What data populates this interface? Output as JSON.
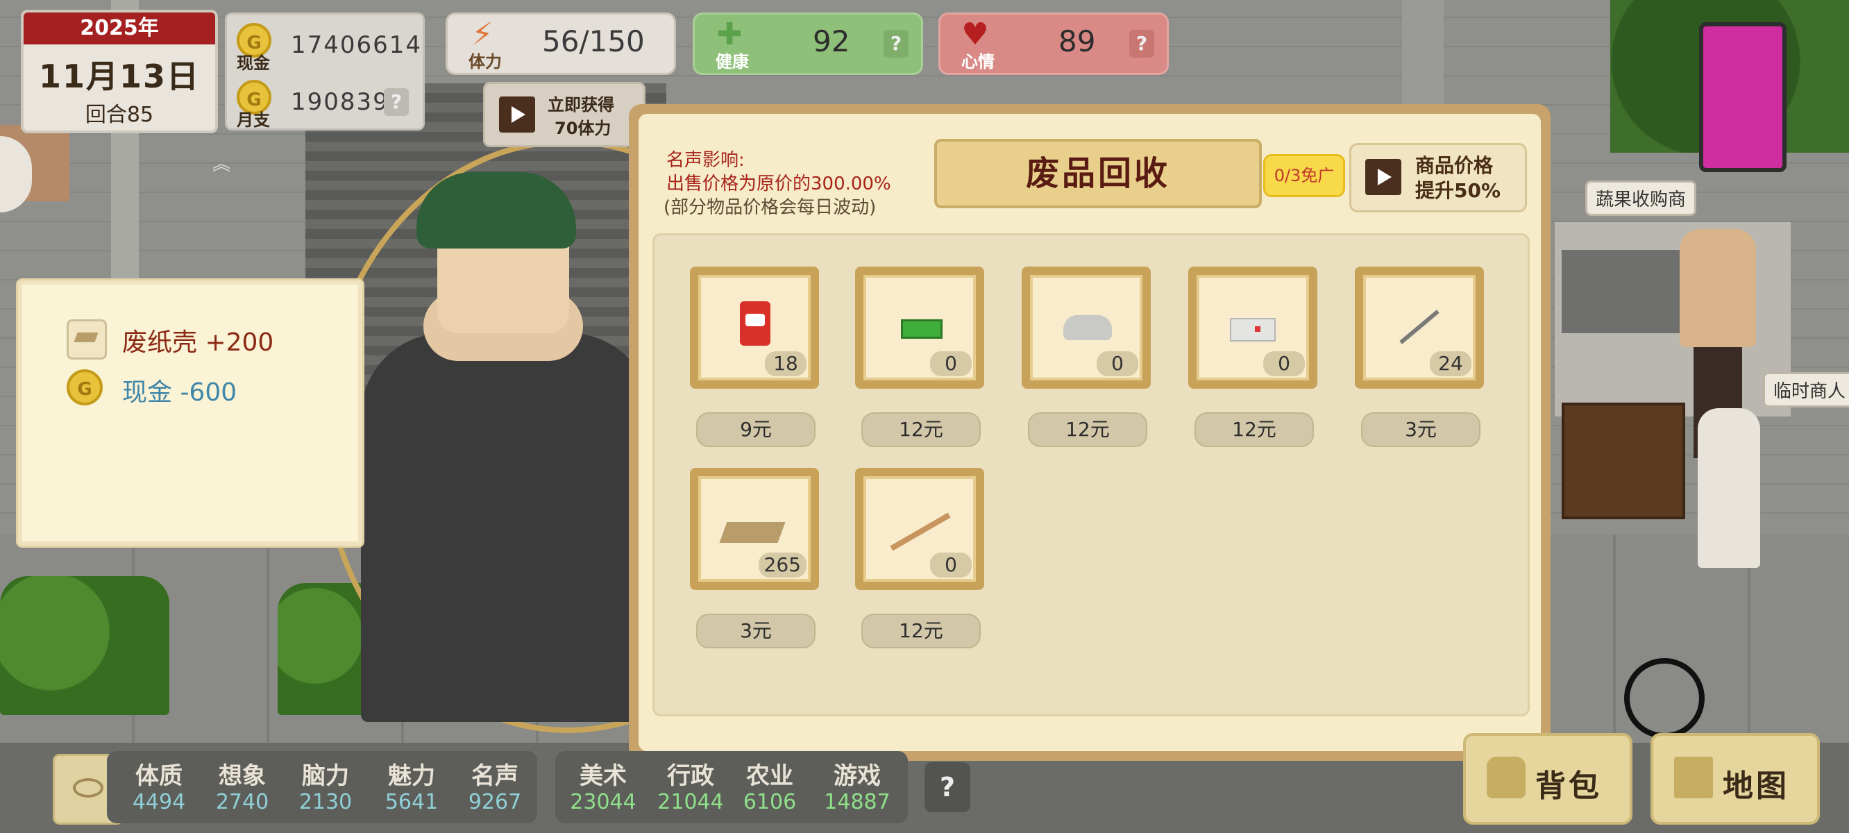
{
  "date": {
    "year": "2025年",
    "day": "11月13日",
    "turn": "回合85"
  },
  "money": {
    "cash_label": "现金",
    "cash_value": "17406614",
    "monthly_label": "月支",
    "monthly_value": "190839",
    "help": "?"
  },
  "stats": {
    "energy": {
      "label": "体力",
      "value": "56/150"
    },
    "health": {
      "label": "健康",
      "value": "92",
      "help": "?"
    },
    "mood": {
      "label": "心情",
      "value": "89",
      "help": "?"
    }
  },
  "energy_ad": {
    "line1": "立即获得",
    "line2": "70体力"
  },
  "gain_popup": {
    "items": [
      {
        "icon": "cardboard-icon",
        "text": "废纸壳 +200",
        "color": "#8b2a14"
      },
      {
        "icon": "coin-icon",
        "text": "现金 -600",
        "color": "#3f86a8"
      }
    ]
  },
  "recycle": {
    "title": "废品回收",
    "fame_heading": "名声影响:",
    "fame_line": "出售价格为原价的300.00%",
    "fame_note": "(部分物品价格会每日波动)",
    "free_ad": "0/3免广",
    "price_boost": {
      "line1": "商品价格",
      "line2": "提升50%"
    },
    "items": [
      {
        "name": "can-icon",
        "count": "18",
        "price": "9元"
      },
      {
        "name": "green-bottle-icon",
        "count": "0",
        "price": "12元"
      },
      {
        "name": "aluminum-pot-icon",
        "count": "0",
        "price": "12元"
      },
      {
        "name": "electronics-icon",
        "count": "0",
        "price": "12元"
      },
      {
        "name": "nail-icon",
        "count": "24",
        "price": "3元"
      },
      {
        "name": "cardboard-icon",
        "count": "265",
        "price": "3元"
      },
      {
        "name": "copper-wire-icon",
        "count": "0",
        "price": "12元"
      }
    ]
  },
  "attributes": [
    {
      "name": "体质",
      "value": "4494"
    },
    {
      "name": "想象",
      "value": "2740"
    },
    {
      "name": "脑力",
      "value": "2130"
    },
    {
      "name": "魅力",
      "value": "5641"
    },
    {
      "name": "名声",
      "value": "9267"
    }
  ],
  "skills": [
    {
      "name": "美术",
      "value": "23044"
    },
    {
      "name": "行政",
      "value": "21044"
    },
    {
      "name": "农业",
      "value": "6106"
    },
    {
      "name": "游戏",
      "value": "14887"
    }
  ],
  "help_button": "?",
  "bag_label": "背包",
  "map_label": "地图",
  "npc_labels": {
    "vegetable_buyer": "蔬果收购商",
    "temp_merchant": "临时商人"
  },
  "colors": {
    "accent_red": "#a52020",
    "panel": "#f6ecc9",
    "frame": "#c9a25a"
  }
}
